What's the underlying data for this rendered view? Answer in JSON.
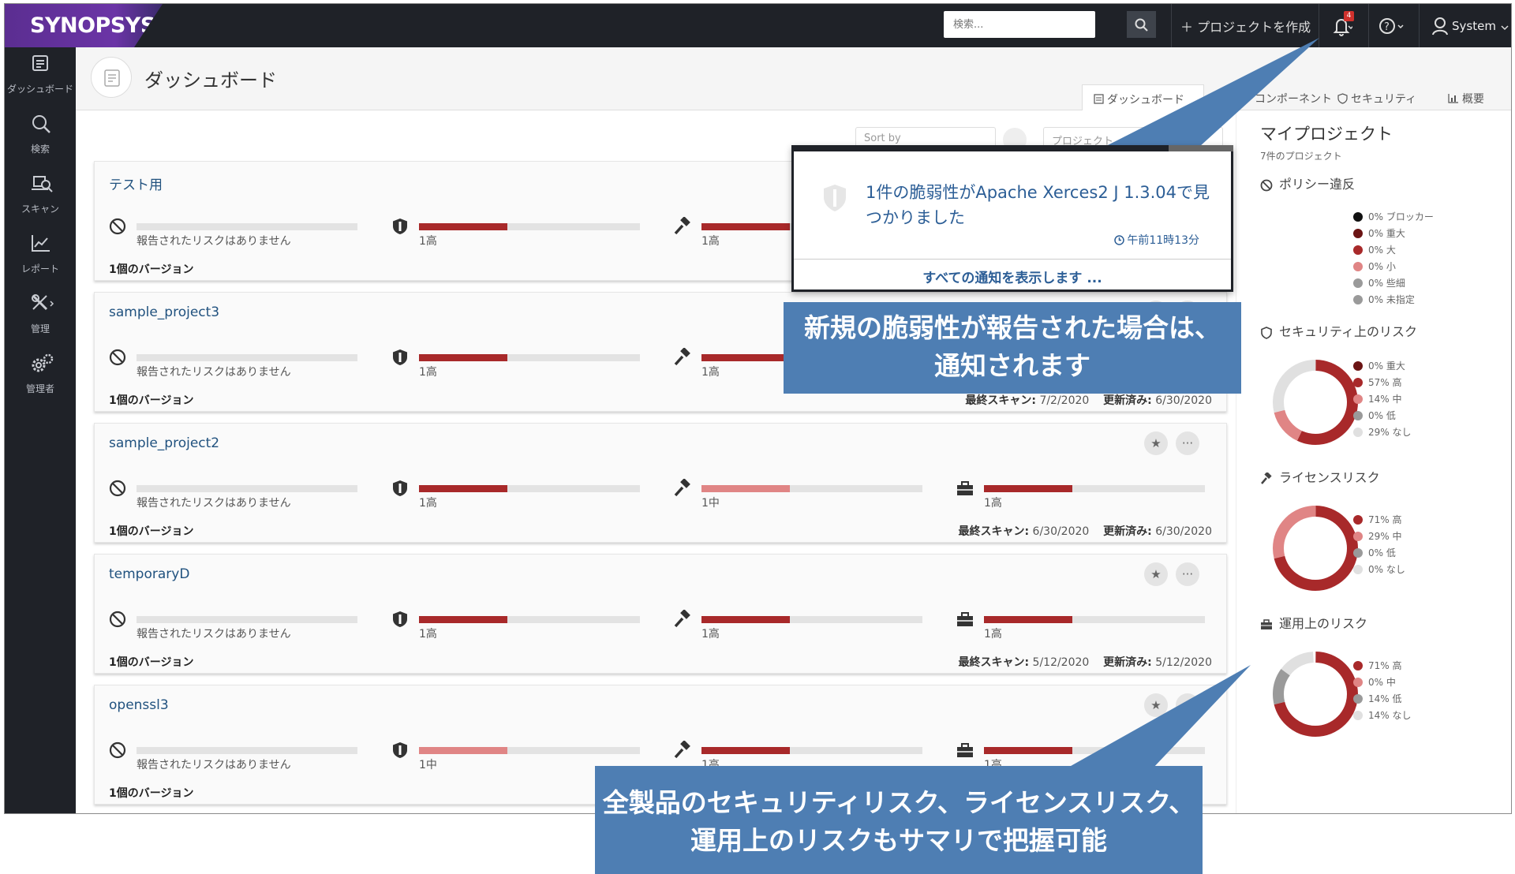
{
  "topbar": {
    "logo": "SYNOPSYS",
    "search_placeholder": "検索...",
    "create_project": "＋ プロジェクトを作成",
    "notification_count": "4",
    "user": "System"
  },
  "sidebar": {
    "items": [
      {
        "label": "ダッシュボード",
        "icon": "dashboard-icon"
      },
      {
        "label": "検索",
        "icon": "search-icon"
      },
      {
        "label": "スキャン",
        "icon": "scan-icon"
      },
      {
        "label": "レポート",
        "icon": "report-icon"
      },
      {
        "label": "管理",
        "icon": "tools-icon"
      },
      {
        "label": "管理者",
        "icon": "gears-icon"
      }
    ]
  },
  "header": {
    "title": "ダッシュボード",
    "tabs": [
      "ダッシュボード",
      "コンポーネント",
      "セキュリティ",
      "概要"
    ]
  },
  "controls": {
    "sort_placeholder": "Sort by",
    "filter_placeholder": "プロジェクト"
  },
  "projects": [
    {
      "name": "テスト用",
      "policy": "報告されたリスクはありません",
      "security": "1高",
      "license": "1高",
      "operational": "",
      "versions": "1個のバージョン",
      "last_scan": "",
      "updated": ""
    },
    {
      "name": "sample_project3",
      "policy": "報告されたリスクはありません",
      "security": "1高",
      "license": "1高",
      "operational": "",
      "versions": "1個のバージョン",
      "last_scan": "7/2/2020",
      "updated": "6/30/2020"
    },
    {
      "name": "sample_project2",
      "policy": "報告されたリスクはありません",
      "security": "1高",
      "license": "1中",
      "operational": "1高",
      "versions": "1個のバージョン",
      "last_scan": "6/30/2020",
      "updated": "6/30/2020"
    },
    {
      "name": "temporaryD",
      "policy": "報告されたリスクはありません",
      "security": "1高",
      "license": "1高",
      "operational": "1高",
      "versions": "1個のバージョン",
      "last_scan": "5/12/2020",
      "updated": "5/12/2020"
    },
    {
      "name": "openssl3",
      "policy": "報告されたリスクはありません",
      "security": "1中",
      "license": "1高",
      "operational": "1高",
      "versions": "1個のバージョン",
      "last_scan": "",
      "updated": ""
    }
  ],
  "labels": {
    "last_scan": "最終スキャン:",
    "updated": "更新済み:"
  },
  "colors": {
    "high": "#a8292a",
    "medium": "#e08585",
    "low": "#9a9a9a",
    "none": "#e0e0e0",
    "blocker": "#111111",
    "critical": "#6b1414",
    "accent_blue": "#2c5e96",
    "callout": "#4e7eb3"
  },
  "right_panel": {
    "title": "マイプロジェクト",
    "subtitle": "7件のプロジェクト",
    "policy": {
      "heading": "ポリシー違反",
      "legend": [
        "0% ブロッカー",
        "0% 重大",
        "0% 大",
        "0% 小",
        "0% 些細",
        "0% 未指定"
      ]
    },
    "security": {
      "heading": "セキュリティ上のリスク",
      "legend": [
        "0% 重大",
        "57% 高",
        "14% 中",
        "0% 低",
        "29% なし"
      ]
    },
    "license": {
      "heading": "ライセンスリスク",
      "legend": [
        "71% 高",
        "29% 中",
        "0% 低",
        "0% なし"
      ]
    },
    "operational": {
      "heading": "運用上のリスク",
      "legend": [
        "71% 高",
        "0% 中",
        "14% 低",
        "14% なし"
      ]
    }
  },
  "notification": {
    "message": "1件の脆弱性がApache Xerces2 J 1.3.04で見つかりました",
    "time": "午前11時13分",
    "view_all": "すべての通知を表示します ..."
  },
  "callouts": {
    "top_line1": "新規の脆弱性が報告された場合は、",
    "top_line2": "通知されます",
    "bottom_line1": "全製品のセキュリティリスク、ライセンスリスク、",
    "bottom_line2": "運用上のリスクもサマリで把握可能"
  }
}
